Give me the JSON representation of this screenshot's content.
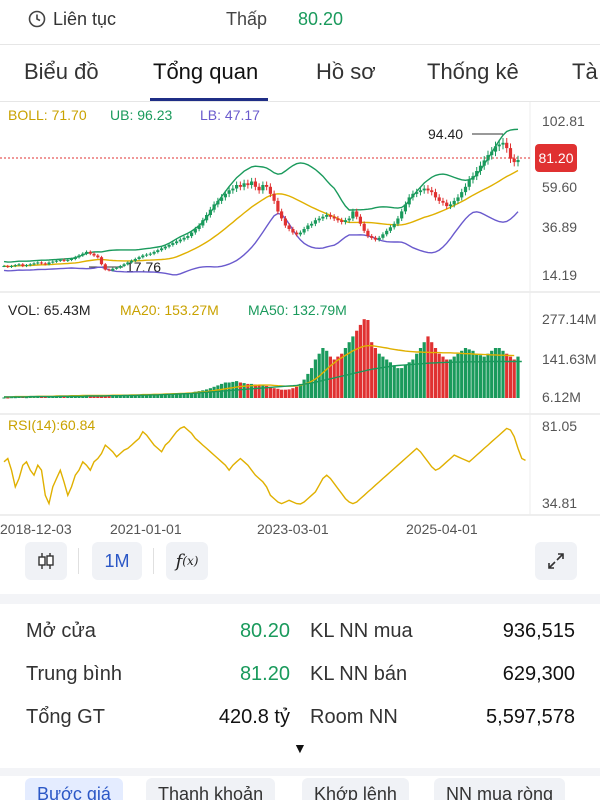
{
  "topbar": {
    "live_label": "Liên tục",
    "low_label": "Thấp",
    "low_value": "80.20"
  },
  "tabs": [
    {
      "label": "Biểu đồ"
    },
    {
      "label": "Tổng quan"
    },
    {
      "label": "Hồ sơ"
    },
    {
      "label": "Thống kê"
    },
    {
      "label": "Tà"
    }
  ],
  "active_tab": "Tổng quan",
  "chart": {
    "boll_label": "BOLL: 71.70",
    "ub_label": "UB: 96.23",
    "lb_label": "LB: 47.17",
    "price_ticks": [
      "102.81",
      "59.60",
      "36.89",
      "14.19"
    ],
    "current_price": "81.20",
    "high_label": "94.40",
    "low_label": "17.76",
    "vol_label": "VOL: 65.43M",
    "ma20_label": "MA20: 153.27M",
    "ma50_label": "MA50: 132.79M",
    "vol_ticks": [
      "277.14M",
      "141.63M",
      "6.12M"
    ],
    "rsi_label": "RSI(14):60.84",
    "rsi_ticks": [
      "81.05",
      "34.81"
    ],
    "date_ticks": [
      "2018-12-03",
      "2021-01-01",
      "2023-03-01",
      "2025-04-01"
    ]
  },
  "toolbar": {
    "candle_icon": "candlestick-icon",
    "interval": "1M",
    "fx_icon": "function-icon",
    "expand_icon": "expand-icon"
  },
  "stats": {
    "open_label": "Mở cửa",
    "open_value": "80.20",
    "avg_label": "Trung bình",
    "avg_value": "81.20",
    "total_label": "Tổng GT",
    "total_value": "420.8 tỷ",
    "fbuy_label": "KL NN mua",
    "fbuy_value": "936,515",
    "fsell_label": "KL NN bán",
    "fsell_value": "629,300",
    "room_label": "Room NN",
    "room_value": "5,597,578",
    "more_icon": "▼"
  },
  "bottom_tabs": [
    {
      "label": "Bước giá"
    },
    {
      "label": "Thanh khoản"
    },
    {
      "label": "Khớp lệnh"
    },
    {
      "label": "NN mua ròng"
    }
  ],
  "colors": {
    "up": "#1a9a5c",
    "down": "#e03131",
    "boll_mid": "#e0b000",
    "boll_upper": "#1a9a5c",
    "boll_lower": "#6a5acd",
    "accent": "#2b57c6",
    "tab_indicator": "#1f2e86"
  },
  "chart_data": {
    "type": "candlestick",
    "price_ylim": [
      14.19,
      102.81
    ],
    "close": [
      21,
      20.5,
      21,
      21.5,
      22,
      21,
      21.5,
      22,
      22.5,
      23,
      22.5,
      22,
      23,
      23.5,
      24,
      24.5,
      24,
      24.5,
      25,
      26,
      27,
      28,
      29,
      28,
      27,
      26,
      22,
      19,
      18.5,
      19.5,
      20,
      21,
      22,
      23,
      24,
      25,
      26,
      27,
      27.5,
      28,
      29,
      30,
      31,
      32,
      33,
      34,
      35,
      36,
      37,
      38,
      40,
      42,
      44,
      47,
      50,
      53,
      56,
      58,
      60,
      62,
      64,
      65,
      67,
      66,
      68,
      67,
      69,
      66,
      64,
      67,
      66,
      62,
      58,
      52,
      48,
      44,
      42,
      40,
      39,
      40,
      42,
      44,
      45,
      47,
      48,
      49,
      50,
      49,
      48,
      47,
      46,
      47,
      48,
      52,
      49,
      45,
      41,
      38,
      37,
      36,
      37,
      39,
      41,
      43,
      45,
      48,
      52,
      56,
      60,
      62,
      63,
      64,
      65,
      64,
      63,
      60,
      58,
      57,
      55,
      56,
      58,
      60,
      63,
      66,
      70,
      72,
      75,
      78,
      81,
      84,
      86,
      89,
      90,
      91,
      88,
      82,
      80,
      81.2
    ],
    "vol_ylim": [
      6.12,
      277.14
    ],
    "volume": [
      8,
      8,
      9,
      9,
      10,
      10,
      9,
      10,
      11,
      11,
      10,
      10,
      11,
      12,
      12,
      12,
      11,
      12,
      13,
      13,
      14,
      15,
      16,
      15,
      14,
      14,
      16,
      15,
      14,
      14,
      14,
      14,
      15,
      15,
      15,
      16,
      16,
      16,
      17,
      17,
      18,
      18,
      19,
      19,
      20,
      20,
      21,
      22,
      22,
      23,
      25,
      28,
      30,
      33,
      36,
      40,
      45,
      50,
      55,
      60,
      60,
      62,
      65,
      60,
      58,
      55,
      55,
      53,
      50,
      50,
      48,
      45,
      40,
      38,
      35,
      35,
      36,
      40,
      45,
      55,
      70,
      90,
      110,
      140,
      160,
      180,
      170,
      150,
      140,
      150,
      160,
      180,
      200,
      220,
      240,
      260,
      280,
      277,
      200,
      180,
      160,
      150,
      140,
      130,
      120,
      110,
      110,
      120,
      130,
      140,
      160,
      180,
      200,
      220,
      200,
      180,
      160,
      150,
      140,
      140,
      150,
      160,
      170,
      180,
      175,
      170,
      160,
      155,
      150,
      160,
      170,
      180,
      180,
      170,
      160,
      150,
      140,
      150,
      65.43
    ],
    "rsi_ylim": [
      30,
      85
    ],
    "rsi": [
      60,
      62,
      55,
      45,
      50,
      58,
      60,
      55,
      52,
      58,
      55,
      40,
      35,
      45,
      50,
      55,
      48,
      40,
      45,
      52,
      55,
      60,
      58,
      55,
      60,
      62,
      65,
      70,
      68,
      66,
      63,
      65,
      67,
      68,
      70,
      72,
      74,
      78,
      76,
      73,
      70,
      68,
      66,
      70,
      72,
      75,
      78,
      80,
      81,
      79,
      77,
      74,
      72,
      70,
      68,
      66,
      64,
      62,
      60,
      58,
      55,
      58,
      60,
      62,
      60,
      58,
      55,
      52,
      50,
      48,
      45,
      40,
      38,
      36,
      35,
      36,
      37,
      36,
      35,
      34.8,
      36,
      38,
      40,
      42,
      46,
      50,
      52,
      50,
      47,
      44,
      41,
      38,
      36,
      35,
      36,
      38,
      40,
      42,
      44,
      46,
      48,
      50,
      52,
      54,
      56,
      58,
      60,
      62,
      64,
      66,
      68,
      66,
      63,
      60,
      57,
      55,
      56,
      58,
      60,
      62,
      64,
      63,
      62,
      61,
      60,
      62,
      64,
      66,
      68,
      70,
      72,
      74,
      76,
      78,
      80,
      79,
      75,
      68,
      62,
      60.84
    ],
    "vol_ma20": [
      10,
      10,
      10,
      11,
      11,
      11,
      11,
      11,
      11,
      12,
      12,
      12,
      12,
      12,
      13,
      13,
      13,
      13,
      14,
      14,
      14,
      15,
      15,
      15,
      15,
      15,
      15,
      15,
      15,
      16,
      16,
      16,
      16,
      16,
      17,
      17,
      17,
      18,
      18,
      18,
      19,
      19,
      19,
      20,
      20,
      21,
      21,
      22,
      22,
      23,
      24,
      25,
      26,
      27,
      28,
      30,
      32,
      34,
      36,
      38,
      40,
      42,
      44,
      46,
      47,
      48,
      49,
      50,
      51,
      51,
      51,
      51,
      50,
      49,
      48,
      47,
      47,
      47,
      48,
      50,
      54,
      58,
      64,
      72,
      82,
      94,
      106,
      118,
      128,
      138,
      146,
      154,
      162,
      170,
      176,
      182,
      186,
      188,
      188,
      186,
      184,
      182,
      180,
      177,
      175,
      173,
      171,
      169,
      168,
      167,
      166,
      166,
      165,
      165,
      164,
      164,
      164,
      163,
      163,
      163,
      162,
      162,
      161,
      160,
      160,
      159,
      158,
      158,
      157,
      157,
      156,
      156,
      155,
      155,
      154,
      154,
      153.3
    ],
    "vol_ma50": [
      10,
      10,
      10,
      10,
      10,
      10,
      10,
      11,
      11,
      11,
      11,
      11,
      11,
      11,
      11,
      12,
      12,
      12,
      12,
      12,
      12,
      12,
      13,
      13,
      13,
      13,
      13,
      13,
      14,
      14,
      14,
      14,
      15,
      15,
      15,
      15,
      16,
      16,
      16,
      17,
      17,
      17,
      18,
      18,
      19,
      19,
      20,
      20,
      21,
      21,
      22,
      23,
      24,
      25,
      26,
      27,
      28,
      29,
      30,
      31,
      32,
      33,
      34,
      35,
      36,
      37,
      38,
      39,
      40,
      41,
      42,
      43,
      44,
      45,
      46,
      47,
      48,
      49,
      50,
      52,
      54,
      56,
      58,
      61,
      64,
      67,
      70,
      73,
      76,
      79,
      82,
      85,
      88,
      91,
      94,
      97,
      100,
      103,
      106,
      108,
      110,
      112,
      114,
      116,
      118,
      119,
      120,
      121,
      122,
      123,
      124,
      125,
      126,
      127,
      128,
      128,
      129,
      129,
      130,
      130,
      131,
      131,
      131,
      132,
      132,
      132,
      132,
      132,
      132,
      133,
      133,
      133,
      133,
      133,
      133,
      133,
      133,
      133,
      132.8
    ]
  }
}
